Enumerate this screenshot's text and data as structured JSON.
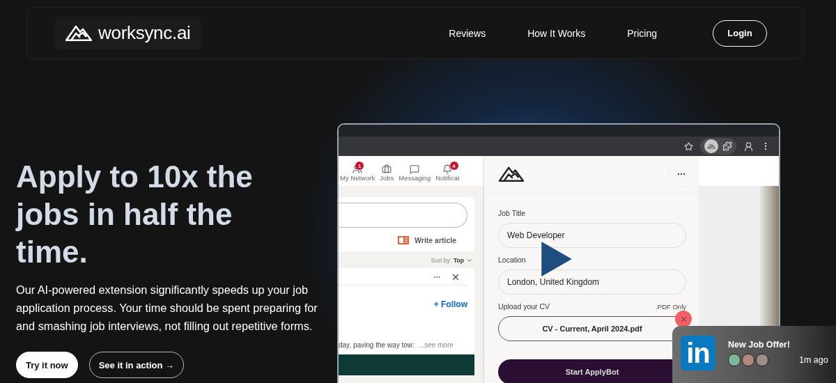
{
  "nav": {
    "logo": "worksync.ai",
    "links": [
      {
        "label": "Reviews"
      },
      {
        "label": "How It Works"
      },
      {
        "label": "Pricing"
      }
    ],
    "login": "Login"
  },
  "hero": {
    "heading": "Apply to 10x the jobs in half the time.",
    "body": "Our AI-powered extension significantly speeds up your job application process. Your time should be spent preparing for and smashing job interviews, not filling out repetitive forms.",
    "buttons": [
      {
        "label": "Try it now",
        "kind": "primary"
      },
      {
        "label": "See it in action →",
        "kind": "outline"
      }
    ]
  },
  "demo": {
    "linkedin": {
      "nav": [
        {
          "label": "My Network",
          "badge": "1"
        },
        {
          "label": "Jobs"
        },
        {
          "label": "Messaging"
        },
        {
          "label": "Notificat",
          "badge": "4"
        }
      ],
      "write_article": "Write article",
      "sort_label": "Sort by:",
      "sort_value": "Top",
      "follow": "+ Follow",
      "snippet": "day, paving the way tow:",
      "see_more": "...see more"
    },
    "extension": {
      "fields": [
        {
          "label": "Job Title",
          "value": "Web Developer"
        },
        {
          "label": "Location",
          "value": "London, United Kingdom"
        }
      ],
      "upload": {
        "label": "Upload your CV",
        "hint": ".PDF Only",
        "file": "CV - Current, April 2024.pdf"
      },
      "submit": "Start ApplyBot"
    }
  },
  "notification": {
    "logo": "in",
    "title": "New Job Offer!",
    "time": "1m ago"
  }
}
